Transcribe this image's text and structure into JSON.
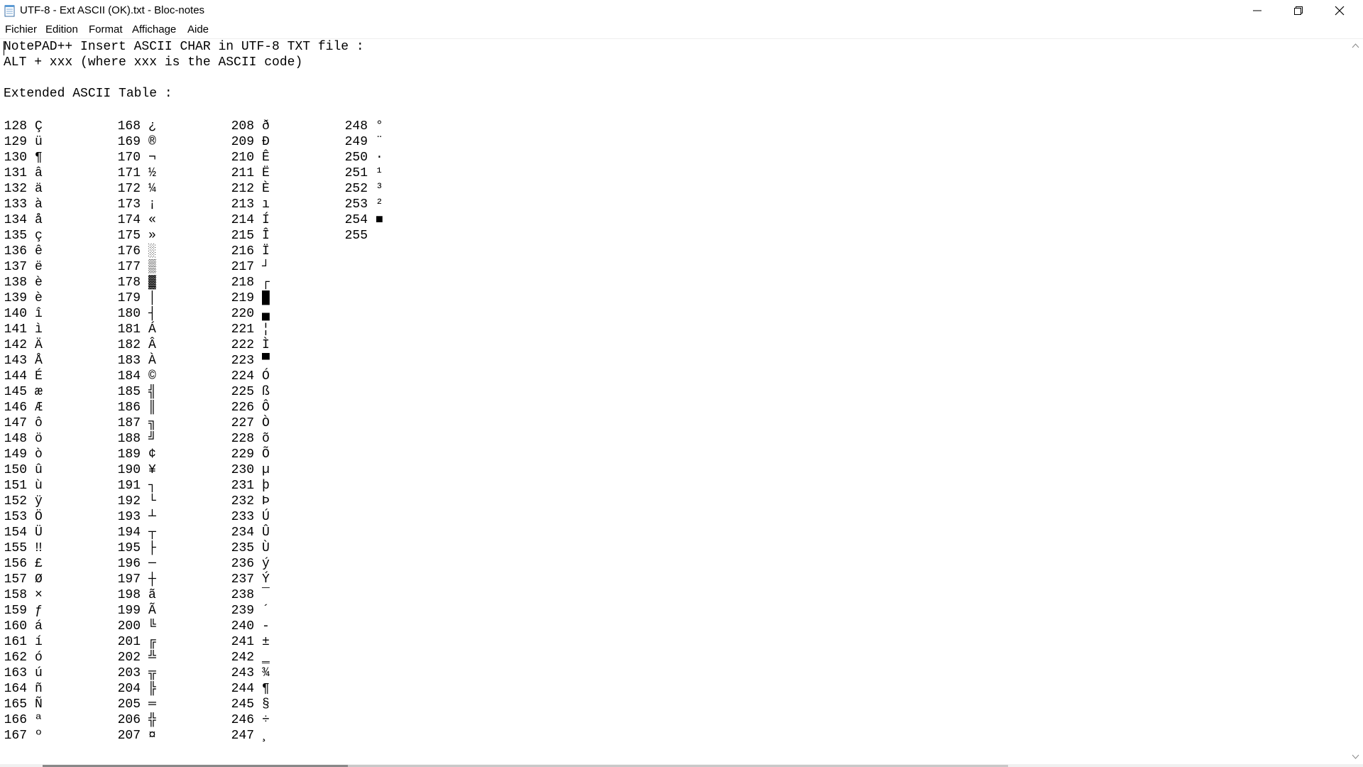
{
  "window": {
    "title": "UTF-8 - Ext ASCII (OK).txt - Bloc-notes",
    "icon": "notepad-icon"
  },
  "menu": [
    "Fichier",
    "Edition",
    "Format",
    "Affichage",
    "Aide"
  ],
  "document": {
    "header_lines": [
      "NotePAD++ Insert ASCII CHAR in UTF-8 TXT file :",
      "ALT + xxx (where xxx is the ASCII code)",
      "",
      "Extended ASCII Table :"
    ],
    "columns": [
      [
        {
          "code": "128",
          "char": "Ç"
        },
        {
          "code": "129",
          "char": "ü"
        },
        {
          "code": "130",
          "char": "¶"
        },
        {
          "code": "131",
          "char": "â"
        },
        {
          "code": "132",
          "char": "ä"
        },
        {
          "code": "133",
          "char": "à"
        },
        {
          "code": "134",
          "char": "å"
        },
        {
          "code": "135",
          "char": "ç"
        },
        {
          "code": "136",
          "char": "ê"
        },
        {
          "code": "137",
          "char": "ë"
        },
        {
          "code": "138",
          "char": "è"
        },
        {
          "code": "139",
          "char": "è"
        },
        {
          "code": "140",
          "char": "î"
        },
        {
          "code": "141",
          "char": "ì"
        },
        {
          "code": "142",
          "char": "Ä"
        },
        {
          "code": "143",
          "char": "Å"
        },
        {
          "code": "144",
          "char": "É"
        },
        {
          "code": "145",
          "char": "æ"
        },
        {
          "code": "146",
          "char": "Æ"
        },
        {
          "code": "147",
          "char": "ô"
        },
        {
          "code": "148",
          "char": "ö"
        },
        {
          "code": "149",
          "char": "ò"
        },
        {
          "code": "150",
          "char": "û"
        },
        {
          "code": "151",
          "char": "ù"
        },
        {
          "code": "152",
          "char": "ÿ"
        },
        {
          "code": "153",
          "char": "Ö"
        },
        {
          "code": "154",
          "char": "Ü"
        },
        {
          "code": "155",
          "char": "‼"
        },
        {
          "code": "156",
          "char": "£"
        },
        {
          "code": "157",
          "char": "Ø"
        },
        {
          "code": "158",
          "char": "×"
        },
        {
          "code": "159",
          "char": "ƒ"
        },
        {
          "code": "160",
          "char": "á"
        },
        {
          "code": "161",
          "char": "í"
        },
        {
          "code": "162",
          "char": "ó"
        },
        {
          "code": "163",
          "char": "ú"
        },
        {
          "code": "164",
          "char": "ñ"
        },
        {
          "code": "165",
          "char": "Ñ"
        },
        {
          "code": "166",
          "char": "ª"
        },
        {
          "code": "167",
          "char": "º"
        }
      ],
      [
        {
          "code": "168",
          "char": "¿"
        },
        {
          "code": "169",
          "char": "®"
        },
        {
          "code": "170",
          "char": "¬"
        },
        {
          "code": "171",
          "char": "½"
        },
        {
          "code": "172",
          "char": "¼"
        },
        {
          "code": "173",
          "char": "¡"
        },
        {
          "code": "174",
          "char": "«"
        },
        {
          "code": "175",
          "char": "»"
        },
        {
          "code": "176",
          "char": "░"
        },
        {
          "code": "177",
          "char": "▒"
        },
        {
          "code": "178",
          "char": "▓"
        },
        {
          "code": "179",
          "char": "│"
        },
        {
          "code": "180",
          "char": "┤"
        },
        {
          "code": "181",
          "char": "Á"
        },
        {
          "code": "182",
          "char": "Â"
        },
        {
          "code": "183",
          "char": "À"
        },
        {
          "code": "184",
          "char": "©"
        },
        {
          "code": "185",
          "char": "╣"
        },
        {
          "code": "186",
          "char": "║"
        },
        {
          "code": "187",
          "char": "╗"
        },
        {
          "code": "188",
          "char": "╝"
        },
        {
          "code": "189",
          "char": "¢"
        },
        {
          "code": "190",
          "char": "¥"
        },
        {
          "code": "191",
          "char": "┐"
        },
        {
          "code": "192",
          "char": "└"
        },
        {
          "code": "193",
          "char": "┴"
        },
        {
          "code": "194",
          "char": "┬"
        },
        {
          "code": "195",
          "char": "├"
        },
        {
          "code": "196",
          "char": "─"
        },
        {
          "code": "197",
          "char": "┼"
        },
        {
          "code": "198",
          "char": "ã"
        },
        {
          "code": "199",
          "char": "Ã"
        },
        {
          "code": "200",
          "char": "╚"
        },
        {
          "code": "201",
          "char": "╔"
        },
        {
          "code": "202",
          "char": "╩"
        },
        {
          "code": "203",
          "char": "╦"
        },
        {
          "code": "204",
          "char": "╠"
        },
        {
          "code": "205",
          "char": "═"
        },
        {
          "code": "206",
          "char": "╬"
        },
        {
          "code": "207",
          "char": "¤"
        }
      ],
      [
        {
          "code": "208",
          "char": "ð"
        },
        {
          "code": "209",
          "char": "Ð"
        },
        {
          "code": "210",
          "char": "Ê"
        },
        {
          "code": "211",
          "char": "Ë"
        },
        {
          "code": "212",
          "char": "È"
        },
        {
          "code": "213",
          "char": "ı"
        },
        {
          "code": "214",
          "char": "Í"
        },
        {
          "code": "215",
          "char": "Î"
        },
        {
          "code": "216",
          "char": "Ï"
        },
        {
          "code": "217",
          "char": "┘"
        },
        {
          "code": "218",
          "char": "┌"
        },
        {
          "code": "219",
          "char": "█"
        },
        {
          "code": "220",
          "char": "▄"
        },
        {
          "code": "221",
          "char": "¦"
        },
        {
          "code": "222",
          "char": "Ì"
        },
        {
          "code": "223",
          "char": "▀"
        },
        {
          "code": "224",
          "char": "Ó"
        },
        {
          "code": "225",
          "char": "ß"
        },
        {
          "code": "226",
          "char": "Ô"
        },
        {
          "code": "227",
          "char": "Ò"
        },
        {
          "code": "228",
          "char": "õ"
        },
        {
          "code": "229",
          "char": "Õ"
        },
        {
          "code": "230",
          "char": "µ"
        },
        {
          "code": "231",
          "char": "þ"
        },
        {
          "code": "232",
          "char": "Þ"
        },
        {
          "code": "233",
          "char": "Ú"
        },
        {
          "code": "234",
          "char": "Û"
        },
        {
          "code": "235",
          "char": "Ù"
        },
        {
          "code": "236",
          "char": "ý"
        },
        {
          "code": "237",
          "char": "Ý"
        },
        {
          "code": "238",
          "char": "¯"
        },
        {
          "code": "239",
          "char": "´"
        },
        {
          "code": "240",
          "char": "-"
        },
        {
          "code": "241",
          "char": "±"
        },
        {
          "code": "242",
          "char": "‗"
        },
        {
          "code": "243",
          "char": "¾"
        },
        {
          "code": "244",
          "char": "¶"
        },
        {
          "code": "245",
          "char": "§"
        },
        {
          "code": "246",
          "char": "÷"
        },
        {
          "code": "247",
          "char": "¸"
        }
      ],
      [
        {
          "code": "248",
          "char": "°"
        },
        {
          "code": "249",
          "char": "¨"
        },
        {
          "code": "250",
          "char": "·"
        },
        {
          "code": "251",
          "char": "¹"
        },
        {
          "code": "252",
          "char": "³"
        },
        {
          "code": "253",
          "char": "²"
        },
        {
          "code": "254",
          "char": "■"
        },
        {
          "code": "255",
          "char": ""
        }
      ]
    ]
  }
}
